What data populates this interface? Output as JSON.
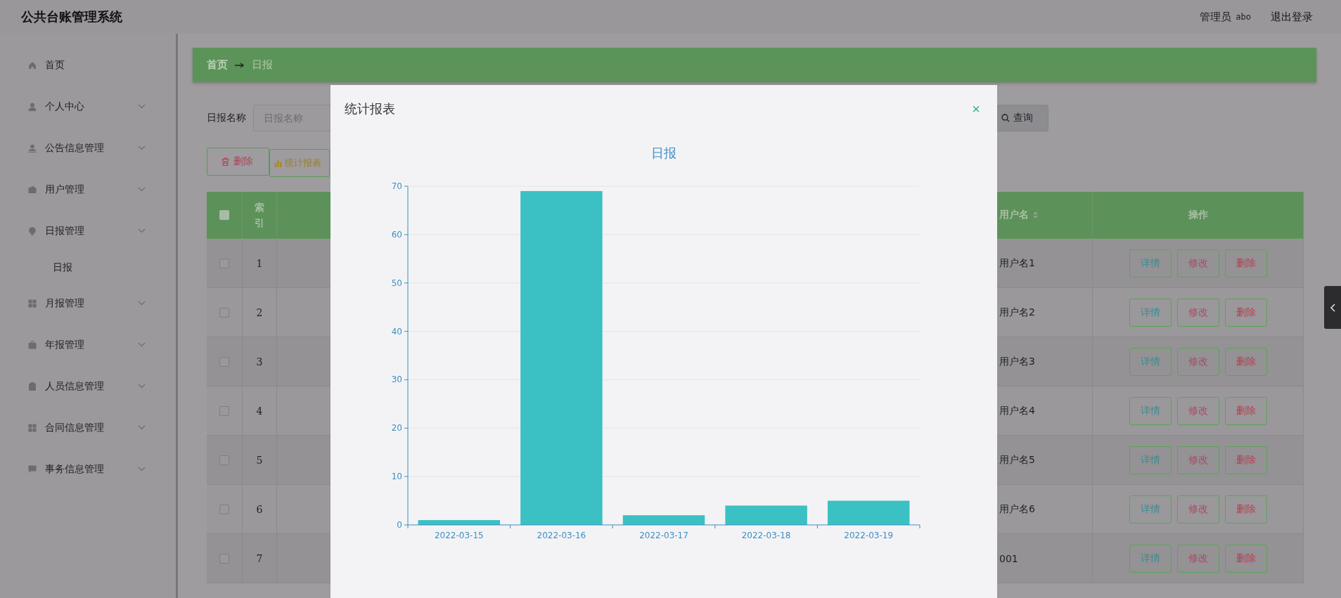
{
  "header": {
    "title": "公共台账管理系统",
    "user_role": "管理员",
    "user_name": "abo",
    "logout": "退出登录"
  },
  "sidebar": {
    "items": [
      {
        "label": "首页",
        "kind": "link"
      },
      {
        "label": "个人中心",
        "kind": "menu"
      },
      {
        "label": "公告信息管理",
        "kind": "menu"
      },
      {
        "label": "用户管理",
        "kind": "menu"
      },
      {
        "label": "日报管理",
        "kind": "menu",
        "children": [
          {
            "label": "日报"
          }
        ]
      },
      {
        "label": "月报管理",
        "kind": "menu"
      },
      {
        "label": "年报管理",
        "kind": "menu"
      },
      {
        "label": "人员信息管理",
        "kind": "menu"
      },
      {
        "label": "合同信息管理",
        "kind": "menu"
      },
      {
        "label": "事务信息管理",
        "kind": "menu"
      }
    ]
  },
  "breadcrumb": [
    "首页",
    "日报"
  ],
  "search": {
    "label": "日报名称",
    "placeholder": "日报名称",
    "query_button": "查询"
  },
  "toolbar": [
    {
      "label": "删除",
      "kind": "delete"
    },
    {
      "label": "统计报表",
      "kind": "chart"
    }
  ],
  "table": {
    "columns": [
      "索引",
      "用户名",
      "操作"
    ],
    "select_all": false,
    "rows": [
      {
        "index": "1",
        "user": "用户名1",
        "selected": false,
        "actions": [
          {
            "label": "详情",
            "kind": "detail"
          },
          {
            "label": "修改",
            "kind": "edit"
          },
          {
            "label": "删除",
            "kind": "delete"
          }
        ]
      },
      {
        "index": "2",
        "user": "用户名2",
        "selected": false,
        "actions": [
          {
            "label": "详情",
            "kind": "detail"
          },
          {
            "label": "修改",
            "kind": "edit"
          },
          {
            "label": "删除",
            "kind": "delete"
          }
        ]
      },
      {
        "index": "3",
        "user": "用户名3",
        "selected": false,
        "actions": [
          {
            "label": "详情",
            "kind": "detail"
          },
          {
            "label": "修改",
            "kind": "edit"
          },
          {
            "label": "删除",
            "kind": "delete"
          }
        ]
      },
      {
        "index": "4",
        "user": "用户名4",
        "selected": false,
        "actions": [
          {
            "label": "详情",
            "kind": "detail"
          },
          {
            "label": "修改",
            "kind": "edit"
          },
          {
            "label": "删除",
            "kind": "delete"
          }
        ]
      },
      {
        "index": "5",
        "user": "用户名5",
        "selected": false,
        "actions": [
          {
            "label": "详情",
            "kind": "detail"
          },
          {
            "label": "修改",
            "kind": "edit"
          },
          {
            "label": "删除",
            "kind": "delete"
          }
        ]
      },
      {
        "index": "6",
        "user": "用户名6",
        "selected": false,
        "actions": [
          {
            "label": "详情",
            "kind": "detail"
          },
          {
            "label": "修改",
            "kind": "edit"
          },
          {
            "label": "删除",
            "kind": "delete"
          }
        ]
      },
      {
        "index": "7",
        "user": "001",
        "selected": false,
        "actions": [
          {
            "label": "详情",
            "kind": "detail"
          },
          {
            "label": "修改",
            "kind": "edit"
          },
          {
            "label": "删除",
            "kind": "delete"
          }
        ]
      }
    ]
  },
  "modal": {
    "title": "统计报表",
    "close": "×",
    "chart_data": {
      "type": "bar",
      "title": "日报",
      "categories": [
        "2022-03-15",
        "2022-03-16",
        "2022-03-17",
        "2022-03-18",
        "2022-03-19"
      ],
      "values": [
        1,
        69,
        2,
        4,
        5
      ],
      "grid": true,
      "ylim": [
        0,
        70
      ],
      "yticks": [
        0,
        10,
        20,
        30,
        40,
        50,
        60,
        70
      ]
    }
  }
}
